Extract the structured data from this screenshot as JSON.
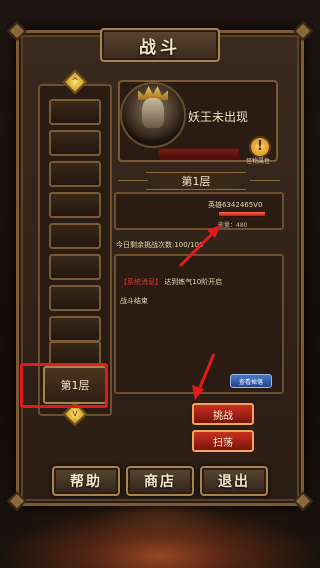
{
  "header": {
    "title": "战斗"
  },
  "boss": {
    "name": "妖王未出现",
    "info_icon": "!",
    "info_label": "怪物属性"
  },
  "floor": {
    "banner": "第1层",
    "current_label": "第1层",
    "empty_slot_count": 9
  },
  "hero": {
    "name": "英雄6342465V0",
    "energy_label": "能量：480",
    "health_fraction": 0.95
  },
  "challenges": {
    "remaining_text": "今日剩余挑战次数:100/100"
  },
  "log": {
    "tag": "【系统消息】",
    "message": "达到练气10阶开启",
    "result": "战斗结束",
    "view_drops": "查看掉落"
  },
  "actions": {
    "challenge": "挑战",
    "sweep": "扫荡"
  },
  "footer": {
    "help": "帮助",
    "shop": "商店",
    "exit": "退出"
  },
  "colors": {
    "highlight": "#e21a1a",
    "button_red": "#c8301e",
    "button_blue": "#4a78c8",
    "gold": "#a88352"
  },
  "icons": {
    "floor_up": "chevron-up-icon",
    "floor_down": "chevron-down-icon",
    "info": "exclamation-icon"
  }
}
